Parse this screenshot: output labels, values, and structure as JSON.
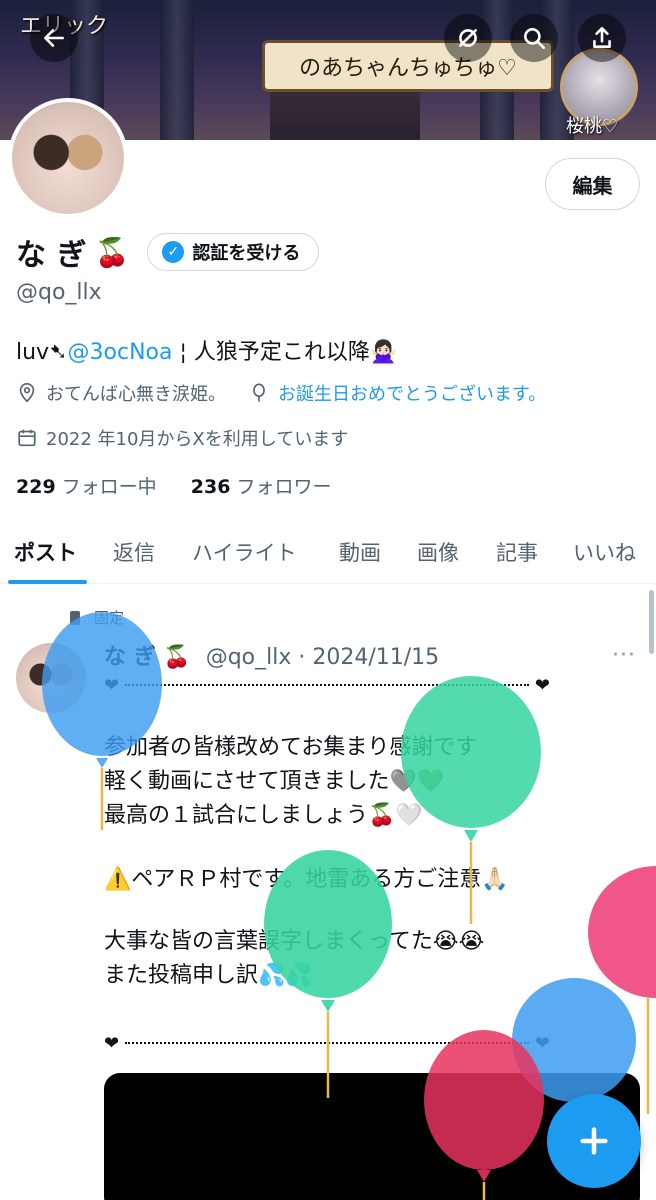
{
  "banner": {
    "left_tag": "エリック",
    "speech": "のあちゃんちゅちゅ♡",
    "right_name": "桜桃♡"
  },
  "header": {
    "back_icon": "back-arrow-icon",
    "translate_icon": "hide-icon",
    "search_icon": "search-icon",
    "share_icon": "share-icon"
  },
  "profile": {
    "edit_label": "編集",
    "display_name": "な ぎ",
    "name_emoji": "🍒",
    "verify_label": "認証を受ける",
    "handle": "@qo_llx",
    "bio_prefix": "luv➷",
    "bio_mention": "@3ocNoa",
    "bio_suffix": "¦  人狼予定これ以降🙅🏻‍♀️",
    "location": "おてんば心無き涙姫。",
    "birthday_link": "お誕生日おめでとうございます。",
    "joined": "2022 年10月からXを利用しています",
    "following_count": "229",
    "following_label": "フォロー中",
    "followers_count": "236",
    "followers_label": "フォロワー"
  },
  "tabs": [
    {
      "label": "ポスト",
      "active": true
    },
    {
      "label": "返信",
      "active": false
    },
    {
      "label": "ハイライト",
      "active": false
    },
    {
      "label": "動画",
      "active": false
    },
    {
      "label": "画像",
      "active": false
    },
    {
      "label": "記事",
      "active": false
    },
    {
      "label": "いいね",
      "active": false
    }
  ],
  "post": {
    "pinned_label": "固定",
    "author_name": "な ぎ 🍒",
    "author_meta": "@qo_llx · 2024/11/15",
    "more": "···",
    "heart": "❤",
    "lines": [
      "参加者の皆様改めてお集まり感謝です",
      "軽く動画にさせて頂きました🩶💚",
      "最高の１試合にしましょう🍒🤍",
      "⚠️ペアＲＰ村です。地雷ある方ご注意🙏🏻",
      "大事な皆の言葉誤字しまくってた😭😭",
      "また投稿申し訳💦💦"
    ]
  },
  "fab_icon": "compose-plus-icon",
  "colors": {
    "accent": "#1d9bf0",
    "text": "#0f1419",
    "muted": "#536471"
  }
}
